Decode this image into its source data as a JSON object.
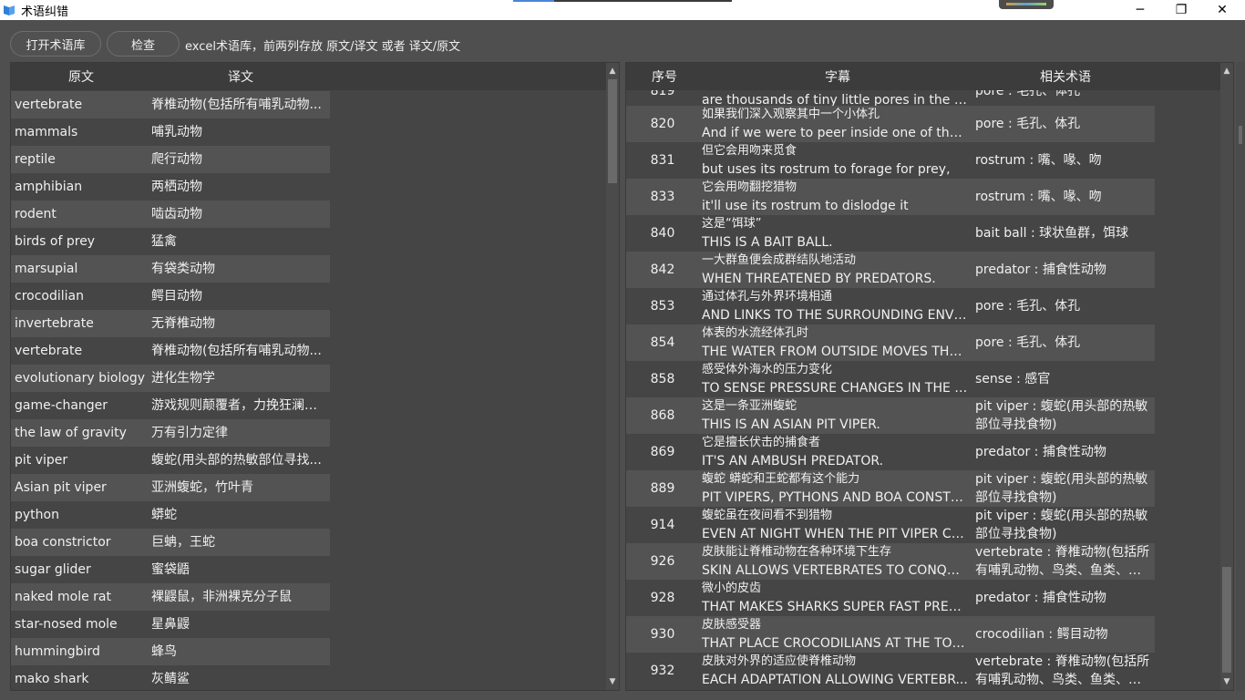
{
  "window": {
    "title": "术语纠错",
    "controls": {
      "minimize": "─",
      "restore": "❐",
      "close": "✕"
    }
  },
  "toolbar": {
    "open_glossary_label": "打开术语库",
    "check_label": "检查",
    "hint": "excel术语库，前两列存放 原文/译文 或者 译文/原文"
  },
  "glossary": {
    "headers": {
      "source": "原文",
      "target": "译文"
    },
    "rows": [
      {
        "source": "vertebrate",
        "target": "脊椎动物(包括所有哺乳动物..."
      },
      {
        "source": "mammals",
        "target": "哺乳动物"
      },
      {
        "source": "reptile",
        "target": "爬行动物"
      },
      {
        "source": "amphibian",
        "target": "两栖动物"
      },
      {
        "source": "rodent",
        "target": "啮齿动物"
      },
      {
        "source": "birds of prey",
        "target": "猛禽"
      },
      {
        "source": "marsupial",
        "target": "有袋类动物"
      },
      {
        "source": "crocodilian",
        "target": "鳄目动物"
      },
      {
        "source": "invertebrate",
        "target": "无脊椎动物"
      },
      {
        "source": "vertebrate",
        "target": "脊椎动物(包括所有哺乳动物..."
      },
      {
        "source": "evolutionary biology",
        "target": "进化生物学"
      },
      {
        "source": "game-changer",
        "target": "游戏规则颠覆者，力挽狂澜的..."
      },
      {
        "source": "the law of gravity",
        "target": "万有引力定律"
      },
      {
        "source": "pit viper",
        "target": "蝮蛇(用头部的热敏部位寻找..."
      },
      {
        "source": "Asian pit viper",
        "target": "亚洲蝮蛇，竹叶青"
      },
      {
        "source": "python",
        "target": "蟒蛇"
      },
      {
        "source": "boa constrictor",
        "target": "巨蚺，王蛇"
      },
      {
        "source": "sugar glider",
        "target": "蜜袋鼯"
      },
      {
        "source": "naked mole rat",
        "target": "裸鼹鼠，非洲裸克分子鼠"
      },
      {
        "source": "star-nosed mole",
        "target": "星鼻鼹"
      },
      {
        "source": "hummingbird",
        "target": "蜂鸟"
      },
      {
        "source": "mako shark",
        "target": "灰鲭鲨"
      }
    ]
  },
  "subtitles": {
    "headers": {
      "index": "序号",
      "subtitle": "字幕",
      "terms": "相关术语"
    },
    "partial_row": {
      "index": "819",
      "en": "are thousands of tiny little pores in the skin.",
      "term": "pore : 毛孔、体孔"
    },
    "rows": [
      {
        "index": "820",
        "zh": "如果我们深入观察其中一个小体孔",
        "en": "And if we were to peer inside one of thes...",
        "term": "pore : 毛孔、体孔"
      },
      {
        "index": "831",
        "zh": "但它会用吻来觅食",
        "en": "but uses its rostrum to forage for prey,",
        "term": "rostrum : 嘴、喙、吻"
      },
      {
        "index": "833",
        "zh": "它会用吻翻挖猎物",
        "en": "it'll use its rostrum to dislodge it",
        "term": "rostrum : 嘴、喙、吻"
      },
      {
        "index": "840",
        "zh": "这是“饵球”",
        "en": "THIS IS A BAIT BALL.",
        "term": "bait ball : 球状鱼群，饵球"
      },
      {
        "index": "842",
        "zh": "一大群鱼便会成群结队地活动",
        "en": "WHEN THREATENED BY PREDATORS.",
        "term": "predator : 捕食性动物"
      },
      {
        "index": "853",
        "zh": "通过体孔与外界环境相通",
        "en": "AND LINKS TO THE SURROUNDING ENVIR...",
        "term": "pore : 毛孔、体孔"
      },
      {
        "index": "854",
        "zh": "体表的水流经体孔时",
        "en": "THE WATER FROM OUTSIDE MOVES THR...",
        "term": "pore : 毛孔、体孔"
      },
      {
        "index": "858",
        "zh": "感受体外海水的压力变化",
        "en": "TO SENSE PRESSURE CHANGES IN THE W...",
        "term": "sense : 感官"
      },
      {
        "index": "868",
        "zh": "这是一条亚洲蝮蛇",
        "en": "THIS IS AN ASIAN PIT VIPER.",
        "term": "pit viper : 蝮蛇(用头部的热敏部位寻找食物)"
      },
      {
        "index": "869",
        "zh": "它是擅长伏击的捕食者",
        "en": "IT'S AN AMBUSH PREDATOR.",
        "term": "predator : 捕食性动物"
      },
      {
        "index": "889",
        "zh": "蝮蛇 蟒蛇和王蛇都有这个能力",
        "en": "PIT VIPERS, PYTHONS AND BOA CONSTRI...",
        "term": "pit viper : 蝮蛇(用头部的热敏部位寻找食物)"
      },
      {
        "index": "914",
        "zh": "蝮蛇虽在夜间看不到猎物",
        "en": "EVEN AT NIGHT WHEN THE PIT VIPER CA...",
        "term": "pit viper : 蝮蛇(用头部的热敏部位寻找食物)"
      },
      {
        "index": "926",
        "zh": "皮肤能让脊椎动物在各种环境下生存",
        "en": "SKIN ALLOWS VERTEBRATES TO CONQUE...",
        "term": "vertebrate : 脊椎动物(包括所有哺乳动物、鸟类、鱼类、爬..."
      },
      {
        "index": "928",
        "zh": "微小的皮齿",
        "en": "THAT MAKES SHARKS SUPER FAST PRED...",
        "term": "predator : 捕食性动物"
      },
      {
        "index": "930",
        "zh": "皮肤感受器",
        "en": "THAT PLACE CROCODILIANS AT THE TOP ...",
        "term": "crocodilian : 鳄目动物"
      },
      {
        "index": "932",
        "zh": "皮肤对外界的适应使脊椎动物",
        "en": "EACH ADAPTATION ALLOWING VERTEBR...",
        "term": "vertebrate : 脊椎动物(包括所有哺乳动物、鸟类、鱼类、爬..."
      }
    ]
  },
  "scroll": {
    "up_arrow": "▲",
    "down_arrow": "▼"
  }
}
